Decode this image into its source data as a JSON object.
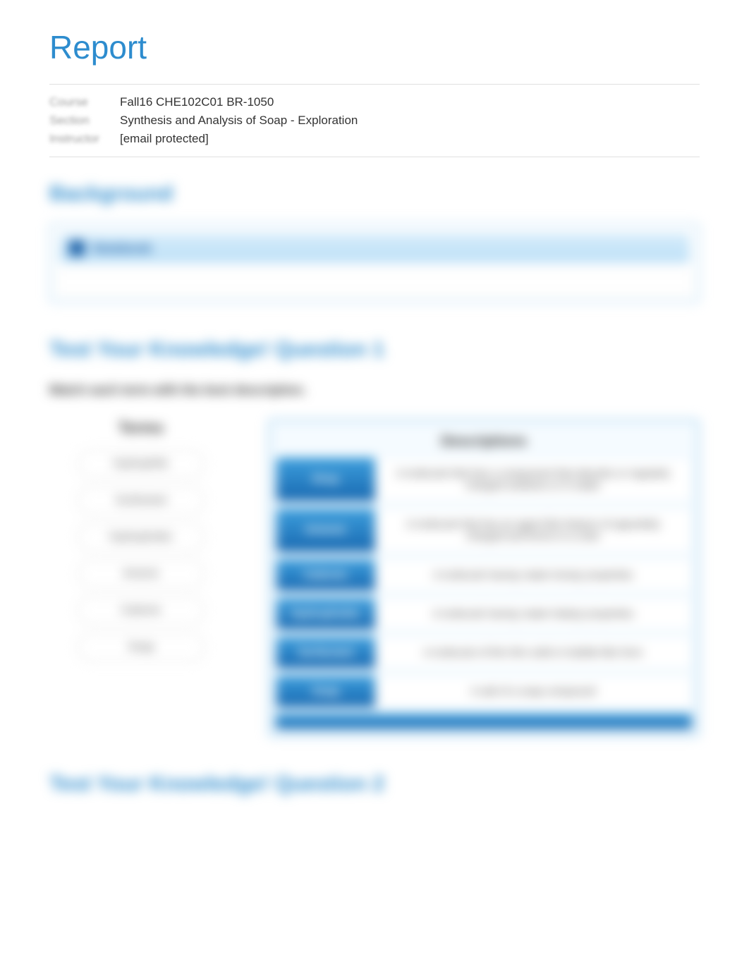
{
  "title": "Report",
  "meta": {
    "label1": "Course",
    "value1": "Fall16 CHE102C01 BR-1050",
    "label2": "Section",
    "value2": "Synthesis and Analysis of Soap - Exploration",
    "label3": "Instructor",
    "value3": "[email protected]"
  },
  "background_heading": "Background",
  "notebook": {
    "title": "Notebook"
  },
  "q1": {
    "heading": "Test Your Knowledge! Question 1",
    "instruction": "Match each term with the best description.",
    "terms_header": "Terms",
    "desc_header": "Descriptions",
    "terms": [
      "Hydrophilic",
      "Surfactant",
      "Hydrophobic",
      "Anionic",
      "Cationic",
      "Soap"
    ],
    "rows": [
      {
        "slot": "Drop",
        "text": "A molecule that has a component that absorbs or regularly charged solutions or in water"
      },
      {
        "slot": "Anionic",
        "text": "A molecule that has an agent like feature of oppositely charged and forms in a color"
      },
      {
        "slot": "Cationic",
        "text": "A molecule having 'water-loving' properties"
      },
      {
        "slot": "Hydrophobic",
        "text": "A molecule having 'water-hating' properties"
      },
      {
        "slot": "Surfactant",
        "text": "A molecule of thin thin solid or bubble-like form"
      },
      {
        "slot": "Soap",
        "text": "A salt of a soap compound"
      }
    ]
  },
  "q2": {
    "heading": "Test Your Knowledge! Question 2"
  }
}
